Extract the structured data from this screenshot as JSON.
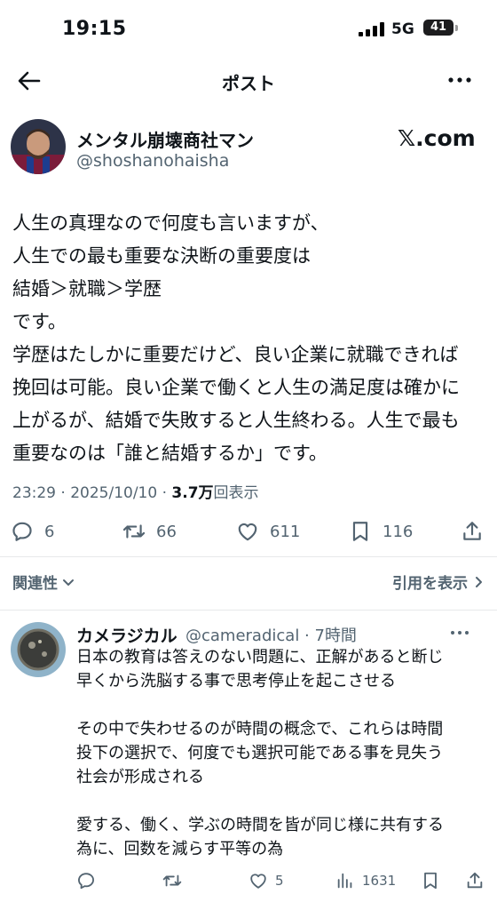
{
  "status_bar": {
    "time": "19:15",
    "network": "5G",
    "battery": "41"
  },
  "nav": {
    "title": "ポスト"
  },
  "post": {
    "author_name": "メンタル崩壊商社マン",
    "author_handle": "@shoshanohaisha",
    "brand": "𝕏.com",
    "lines": [
      "人生の真理なので何度も言いますが、",
      "人生での最も重要な決断の重要度は",
      "結婚＞就職＞学歴",
      "です。",
      "学歴はたしかに重要だけど、良い企業に就職できれば",
      "挽回は可能。良い企業で働くと人生の満足度は確かに",
      "上がるが、結婚で失敗すると人生終わる。人生で最も",
      "重要なのは「誰と結婚するか」です。"
    ],
    "timestamp": "23:29 · 2025/10/10 · ",
    "views_count": "3.7万",
    "views_label": "回表示",
    "stats": {
      "replies": "6",
      "reposts": "66",
      "likes": "611",
      "bookmarks": "116"
    }
  },
  "sort": {
    "label": "関連性"
  },
  "quotes": {
    "label": "引用を表示"
  },
  "reply": {
    "author_name": "カメラジカル",
    "author_meta": "@cameradical · 7時間",
    "lines": [
      "日本の教育は答えのない問題に、正解があると断じ",
      "早くから洗脳する事で思考停止を起こさせる",
      "",
      "その中で失わせるのが時間の概念で、これらは時間",
      "投下の選択で、何度でも選択可能である事を見失う",
      "社会が形成される",
      "",
      "愛する、働く、学ぶの時間を皆が同じ様に共有する",
      "為に、回数を減らす平等の為"
    ],
    "stats": {
      "likes": "5",
      "views": "1631"
    }
  },
  "colors": {
    "text": "#0f1419",
    "secondary": "#536471",
    "divider": "#e7e9ea"
  }
}
